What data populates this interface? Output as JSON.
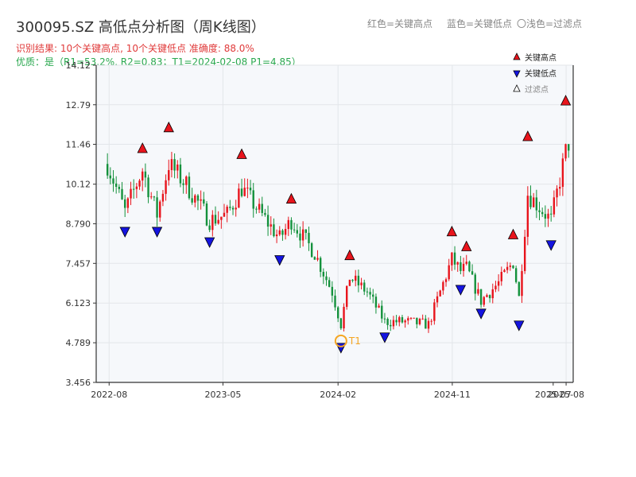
{
  "header": {
    "title": "300095.SZ 高低点分析图（周K线图）",
    "legend_high": "红色=关键高点",
    "legend_low": "蓝色=关键低点",
    "legend_filtered": "〇浅色=过滤点",
    "result_line": "识别结果: 10个关键高点, 10个关键低点   准确度: 88.0%",
    "quality_line": "优质：是（R1=53.2%, R2=0.83；T1=2024-02-08 P1=4.85）"
  },
  "chart_data": {
    "type": "candlestick",
    "ylim": [
      3.456,
      14.12
    ],
    "y_ticks": [
      "3.456",
      "4.789",
      "6.123",
      "7.457",
      "8.790",
      "10.12",
      "11.46",
      "12.79",
      "14.12"
    ],
    "x_ticks": [
      "2022-08",
      "2023-05",
      "2024-02",
      "2024-11",
      "2025-08"
    ],
    "x_tick_extra": "2025-07",
    "legend": [
      {
        "label": "关键高点",
        "color": "#e8141c",
        "marker": "triangle-up"
      },
      {
        "label": "关键低点",
        "color": "#1414e0",
        "marker": "triangle-down"
      },
      {
        "label": "过滤点",
        "color": "#ffffff",
        "marker": "triangle-up-outline"
      }
    ],
    "annotation": {
      "label": "T1",
      "date": "2024-02-08",
      "value": 4.85
    },
    "highs": [
      {
        "date": "2022-10-20",
        "value": 11.1
      },
      {
        "date": "2022-12-22",
        "value": 11.8
      },
      {
        "date": "2023-06-15",
        "value": 10.9
      },
      {
        "date": "2023-10-12",
        "value": 9.4
      },
      {
        "date": "2024-02-29",
        "value": 7.5
      },
      {
        "date": "2024-10-31",
        "value": 8.3
      },
      {
        "date": "2024-12-05",
        "value": 7.8
      },
      {
        "date": "2025-03-27",
        "value": 8.2
      },
      {
        "date": "2025-05-01",
        "value": 11.5
      },
      {
        "date": "2025-07-31",
        "value": 12.7
      }
    ],
    "lows": [
      {
        "date": "2022-09-08",
        "value": 8.75
      },
      {
        "date": "2022-11-24",
        "value": 8.75
      },
      {
        "date": "2023-03-30",
        "value": 8.4
      },
      {
        "date": "2023-09-14",
        "value": 7.8
      },
      {
        "date": "2024-02-08",
        "value": 4.85
      },
      {
        "date": "2024-05-23",
        "value": 5.2
      },
      {
        "date": "2024-11-21",
        "value": 6.8
      },
      {
        "date": "2025-01-09",
        "value": 6.0
      },
      {
        "date": "2025-04-10",
        "value": 5.6
      },
      {
        "date": "2025-06-26",
        "value": 8.3
      }
    ],
    "candles_anchor": [
      [
        "2022-07-28",
        10.8
      ],
      [
        "2022-09-08",
        9.2
      ],
      [
        "2022-10-20",
        10.6
      ],
      [
        "2022-11-24",
        9.1
      ],
      [
        "2022-12-22",
        10.8
      ],
      [
        "2023-02-02",
        10.1
      ],
      [
        "2023-03-30",
        8.9
      ],
      [
        "2023-05-11",
        9.1
      ],
      [
        "2023-06-15",
        10.0
      ],
      [
        "2023-07-27",
        9.2
      ],
      [
        "2023-09-14",
        8.3
      ],
      [
        "2023-10-12",
        8.9
      ],
      [
        "2023-12-07",
        7.8
      ],
      [
        "2024-01-18",
        6.5
      ],
      [
        "2024-02-08",
        5.4
      ],
      [
        "2024-02-29",
        7.0
      ],
      [
        "2024-04-11",
        6.5
      ],
      [
        "2024-05-23",
        5.5
      ],
      [
        "2024-07-11",
        5.5
      ],
      [
        "2024-09-05",
        5.4
      ],
      [
        "2024-10-31",
        7.6
      ],
      [
        "2024-11-21",
        7.2
      ],
      [
        "2024-12-05",
        7.3
      ],
      [
        "2025-01-09",
        6.2
      ],
      [
        "2025-02-20",
        6.8
      ],
      [
        "2025-03-27",
        7.5
      ],
      [
        "2025-04-10",
        6.3
      ],
      [
        "2025-05-01",
        9.8
      ],
      [
        "2025-06-26",
        8.9
      ],
      [
        "2025-07-31",
        11.2
      ],
      [
        "2025-08-07",
        11.5
      ]
    ]
  }
}
